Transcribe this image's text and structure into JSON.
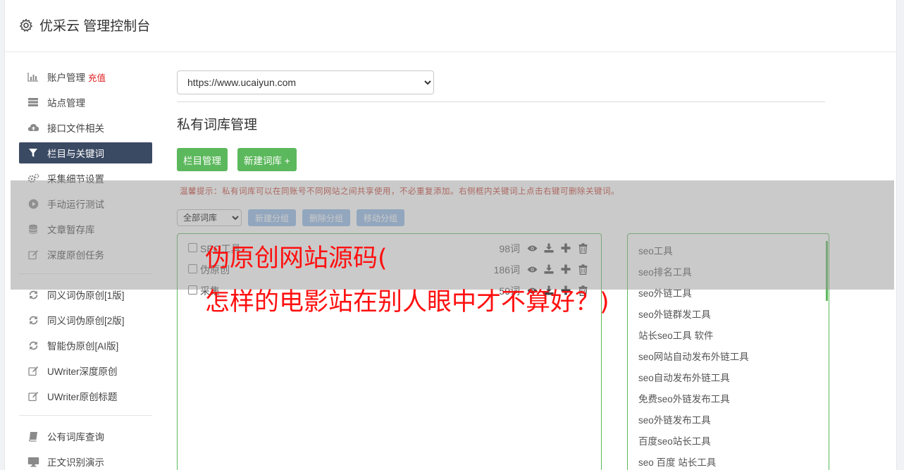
{
  "header": {
    "title": "优采云 管理控制台"
  },
  "sidebar": {
    "group1": [
      {
        "label": "账户管理",
        "badge": "充值",
        "icon": "bar-chart-icon"
      },
      {
        "label": "站点管理",
        "icon": "server-icon"
      },
      {
        "label": "接口文件相关",
        "icon": "cloud-upload-icon"
      },
      {
        "label": "栏目与关键词",
        "icon": "filter-icon",
        "active": true
      },
      {
        "label": "采集细节设置",
        "icon": "cogs-icon"
      },
      {
        "label": "手动运行测试",
        "icon": "play-circle-icon"
      },
      {
        "label": "文章暂存库",
        "icon": "database-icon"
      },
      {
        "label": "深度原创任务",
        "icon": "edit-icon"
      }
    ],
    "group2": [
      {
        "label": "同义词伪原创[1版]",
        "icon": "refresh-icon"
      },
      {
        "label": "同义词伪原创[2版]",
        "icon": "refresh-icon"
      },
      {
        "label": "智能伪原创[AI版]",
        "icon": "refresh-icon"
      },
      {
        "label": "UWriter深度原创",
        "icon": "edit-icon"
      },
      {
        "label": "UWriter原创标题",
        "icon": "edit-icon"
      }
    ],
    "group3": [
      {
        "label": "公有词库查询",
        "icon": "book-icon"
      },
      {
        "label": "正文识别演示",
        "icon": "desktop-icon"
      }
    ]
  },
  "main": {
    "site_select": "https://www.ucaiyun.com",
    "section_title": "私有词库管理",
    "btn_column": "栏目管理",
    "btn_new_lib": "新建词库 +",
    "tip": "温馨提示：私有词库可以在同账号不同网站之间共享使用，不必重复添加。右侧框内关键词上点击右键可删除关键词。",
    "lib_filter": "全部词库",
    "btn_new_group": "新建分组",
    "btn_delete_group": "删除分组",
    "btn_move_group": "移动分组",
    "libraries": [
      {
        "name": "SEO工具",
        "count": "98词"
      },
      {
        "name": "伪原创",
        "count": "186词"
      },
      {
        "name": "采集",
        "count": "59词"
      }
    ],
    "keywords": [
      "seo工具",
      "seo排名工具",
      "seo外链工具",
      "seo外链群发工具",
      "站长seo工具 软件",
      "seo网站自动发布外链工具",
      "seo自动发布外链工具",
      "免费seo外链发布工具",
      "seo外链发布工具",
      "百度seo站长工具",
      "seo 百度 站长工具"
    ]
  },
  "watermark": {
    "line1": "伪原创网站源码(",
    "line2": "怎样的电影站在别人眼中才不算好？)"
  },
  "colors": {
    "accent_green": "#5cb85c",
    "nav_active": "#3b4a63",
    "watermark_red": "#ff1010"
  }
}
